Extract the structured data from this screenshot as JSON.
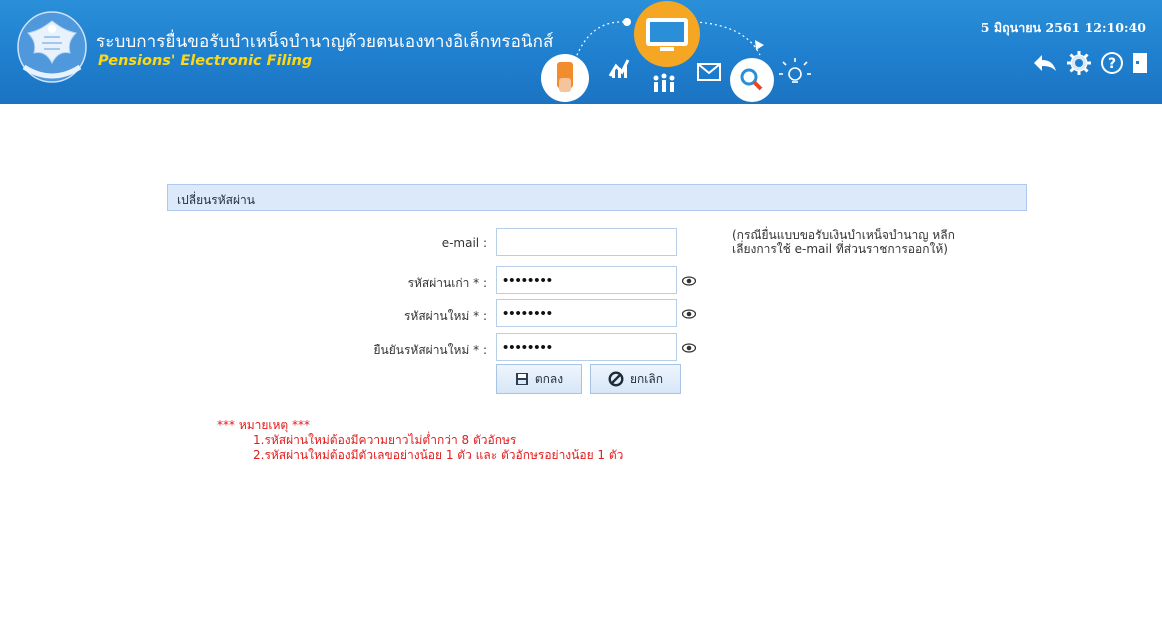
{
  "header": {
    "title_th": "ระบบการยื่นขอรับบำเหน็จบำนาญด้วยตนเองทางอิเล็กทรอนิกส์",
    "title_en": "Pensions' Electronic Filing",
    "datetime": "5 มิถุนายน 2561 12:10:40",
    "tools": [
      {
        "icon": "back-arrow-icon"
      },
      {
        "icon": "gear-icon"
      },
      {
        "icon": "help-icon"
      },
      {
        "icon": "logout-icon"
      }
    ]
  },
  "panel": {
    "title": "เปลี่ยนรหัสผ่าน"
  },
  "form": {
    "email": {
      "label": "e-mail :",
      "value": ""
    },
    "old_password": {
      "label": "รหัสผ่านเก่า * :",
      "value": "••••••••"
    },
    "new_password": {
      "label": "รหัสผ่านใหม่ * :",
      "value": "••••••••"
    },
    "confirm_password": {
      "label": "ยืนยันรหัสผ่านใหม่ * :",
      "value": "••••••••"
    },
    "email_note_line1": "(กรณียื่นแบบขอรับเงินบำเหน็จบำนาญ หลีก",
    "email_note_line2": "เลี่ยงการใช้ e-mail ที่ส่วนราชการออกให้)",
    "ok_label": "ตกลง",
    "cancel_label": "ยกเลิก"
  },
  "remarks": {
    "title": "*** หมายเหตุ ***",
    "line1": "1.รหัสผ่านใหม่ต้องมีความยาวไม่ต่ำกว่า 8 ตัวอักษร",
    "line2": "2.รหัสผ่านใหม่ต้องมีตัวเลขอย่างน้อย 1 ตัว และ ตัวอักษรอย่างน้อย 1 ตัว"
  },
  "colors": {
    "header_blue": "#1f7fcf",
    "title_yellow": "#ffd814",
    "remark_red": "#e31b1b",
    "panel_bg": "#dce9fb"
  }
}
